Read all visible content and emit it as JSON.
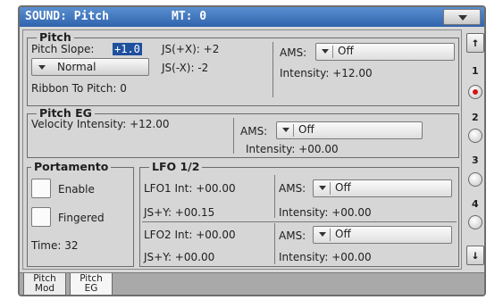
{
  "header": {
    "title": "SOUND: Pitch",
    "mt": "MT: 0"
  },
  "pitch": {
    "title": "Pitch",
    "slope_label": "Pitch Slope:",
    "slope_value": "+1.0",
    "js_plus": "JS(+X): +2",
    "js_minus": "JS(-X): -2",
    "mode": "Normal",
    "ribbon": "Ribbon To Pitch:  0",
    "ams_label": "AMS:",
    "ams_value": "Off",
    "intensity": "Intensity: +12.00"
  },
  "pitch_eg": {
    "title": "Pitch EG",
    "velocity": "Velocity Intensity: +12.00",
    "ams_label": "AMS:",
    "ams_value": "Off",
    "intensity": "Intensity: +00.00"
  },
  "portamento": {
    "title": "Portamento",
    "enable": "Enable",
    "fingered": "Fingered",
    "time": "Time: 32"
  },
  "lfo": {
    "title": "LFO 1/2",
    "lfo1_int": "LFO1 Int: +00.00",
    "lfo1_js": "JS+Y:     +00.15",
    "lfo1_ams_label": "AMS:",
    "lfo1_ams_value": "Off",
    "lfo1_intensity": "Intensity:  +00.00",
    "lfo2_int": "LFO2 Int: +00.00",
    "lfo2_js": "JS+Y:     +00.00",
    "lfo2_ams_label": "AMS:",
    "lfo2_ams_value": "Off",
    "lfo2_intensity": "Intensity:  +00.00"
  },
  "side": {
    "up": "↑",
    "down": "↓",
    "pages": [
      "1",
      "2",
      "3",
      "4"
    ]
  },
  "tabs": [
    {
      "line1": "Pitch",
      "line2": "Mod"
    },
    {
      "line1": "Pitch",
      "line2": "EG"
    }
  ],
  "colors": {
    "title_bar": "#3f74bf",
    "selection": "#1f4f9f",
    "radio_on": "#d21616"
  }
}
